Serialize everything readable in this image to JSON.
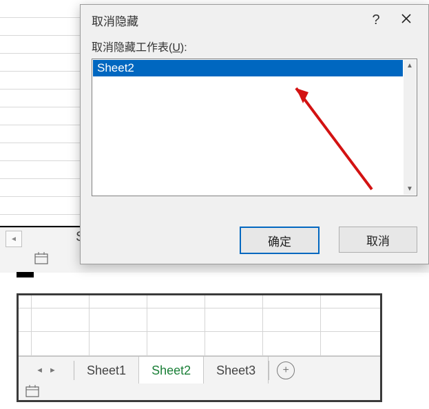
{
  "dialog": {
    "title": "取消隐藏",
    "label_prefix": "取消隐藏工作表(",
    "label_key": "U",
    "label_suffix": "):",
    "list_items": [
      "Sheet2"
    ],
    "ok_label": "确定",
    "cancel_label": "取消",
    "help_symbol": "?"
  },
  "bg_sheet_fragment": "S",
  "bottom": {
    "tabs": [
      {
        "label": "Sheet1",
        "active": false
      },
      {
        "label": "Sheet2",
        "active": true
      },
      {
        "label": "Sheet3",
        "active": false
      }
    ],
    "add_symbol": "+"
  },
  "icons": {
    "nav_left": "◄",
    "nav_right": "►",
    "scroll_up": "▲",
    "scroll_down": "▼"
  }
}
